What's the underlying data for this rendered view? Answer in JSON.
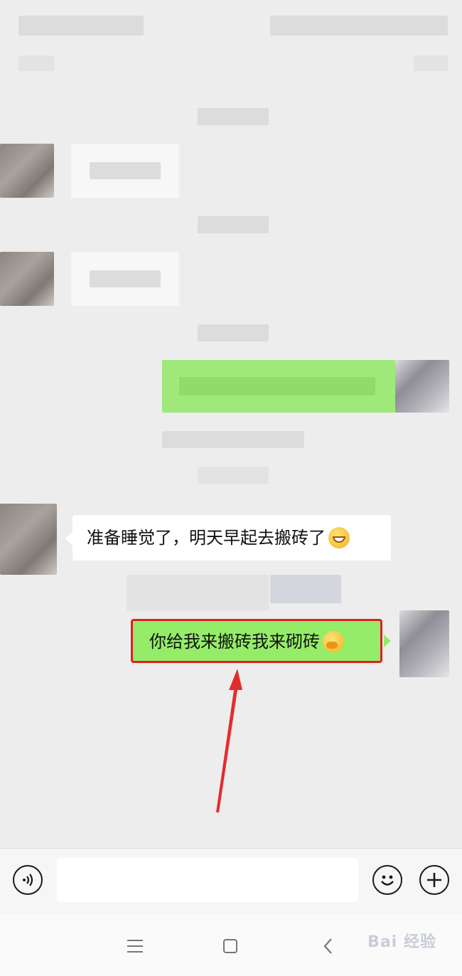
{
  "messages": [
    {
      "side": "left",
      "text": "准备睡觉了，明天早起去搬砖了",
      "emoji": "grinning-emoji"
    },
    {
      "side": "right",
      "text": "你给我来搬砖我来砌砖",
      "emoji": "covering-mouth-emoji",
      "highlighted": true
    }
  ],
  "input_bar": {
    "voice_icon": "voice-icon",
    "input_value": "",
    "emoji_icon": "smiley-icon",
    "more_icon": "plus-icon"
  },
  "nav_bar": {
    "menu_icon": "menu-icon",
    "home_icon": "square-home-icon",
    "back_icon": "back-chevron-icon"
  },
  "watermark": {
    "text": "Bai 经验"
  },
  "colors": {
    "background": "#ededed",
    "green_bubble": "#95ec69",
    "white_bubble": "#ffffff",
    "highlight": "#e02020"
  }
}
